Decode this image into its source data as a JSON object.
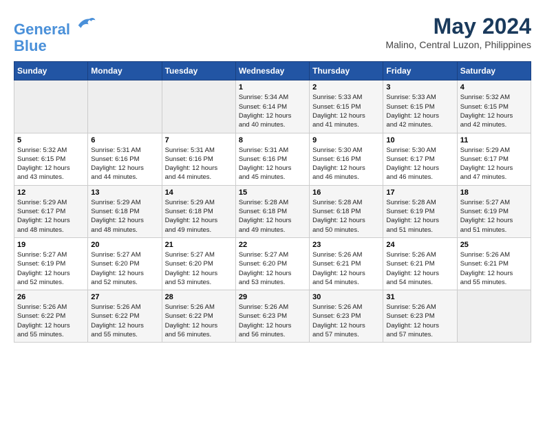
{
  "header": {
    "logo_line1": "General",
    "logo_line2": "Blue",
    "month_year": "May 2024",
    "location": "Malino, Central Luzon, Philippines"
  },
  "days_of_week": [
    "Sunday",
    "Monday",
    "Tuesday",
    "Wednesday",
    "Thursday",
    "Friday",
    "Saturday"
  ],
  "weeks": [
    [
      {
        "day": "",
        "info": ""
      },
      {
        "day": "",
        "info": ""
      },
      {
        "day": "",
        "info": ""
      },
      {
        "day": "1",
        "info": "Sunrise: 5:34 AM\nSunset: 6:14 PM\nDaylight: 12 hours\nand 40 minutes."
      },
      {
        "day": "2",
        "info": "Sunrise: 5:33 AM\nSunset: 6:15 PM\nDaylight: 12 hours\nand 41 minutes."
      },
      {
        "day": "3",
        "info": "Sunrise: 5:33 AM\nSunset: 6:15 PM\nDaylight: 12 hours\nand 42 minutes."
      },
      {
        "day": "4",
        "info": "Sunrise: 5:32 AM\nSunset: 6:15 PM\nDaylight: 12 hours\nand 42 minutes."
      }
    ],
    [
      {
        "day": "5",
        "info": "Sunrise: 5:32 AM\nSunset: 6:15 PM\nDaylight: 12 hours\nand 43 minutes."
      },
      {
        "day": "6",
        "info": "Sunrise: 5:31 AM\nSunset: 6:16 PM\nDaylight: 12 hours\nand 44 minutes."
      },
      {
        "day": "7",
        "info": "Sunrise: 5:31 AM\nSunset: 6:16 PM\nDaylight: 12 hours\nand 44 minutes."
      },
      {
        "day": "8",
        "info": "Sunrise: 5:31 AM\nSunset: 6:16 PM\nDaylight: 12 hours\nand 45 minutes."
      },
      {
        "day": "9",
        "info": "Sunrise: 5:30 AM\nSunset: 6:16 PM\nDaylight: 12 hours\nand 46 minutes."
      },
      {
        "day": "10",
        "info": "Sunrise: 5:30 AM\nSunset: 6:17 PM\nDaylight: 12 hours\nand 46 minutes."
      },
      {
        "day": "11",
        "info": "Sunrise: 5:29 AM\nSunset: 6:17 PM\nDaylight: 12 hours\nand 47 minutes."
      }
    ],
    [
      {
        "day": "12",
        "info": "Sunrise: 5:29 AM\nSunset: 6:17 PM\nDaylight: 12 hours\nand 48 minutes."
      },
      {
        "day": "13",
        "info": "Sunrise: 5:29 AM\nSunset: 6:18 PM\nDaylight: 12 hours\nand 48 minutes."
      },
      {
        "day": "14",
        "info": "Sunrise: 5:29 AM\nSunset: 6:18 PM\nDaylight: 12 hours\nand 49 minutes."
      },
      {
        "day": "15",
        "info": "Sunrise: 5:28 AM\nSunset: 6:18 PM\nDaylight: 12 hours\nand 49 minutes."
      },
      {
        "day": "16",
        "info": "Sunrise: 5:28 AM\nSunset: 6:18 PM\nDaylight: 12 hours\nand 50 minutes."
      },
      {
        "day": "17",
        "info": "Sunrise: 5:28 AM\nSunset: 6:19 PM\nDaylight: 12 hours\nand 51 minutes."
      },
      {
        "day": "18",
        "info": "Sunrise: 5:27 AM\nSunset: 6:19 PM\nDaylight: 12 hours\nand 51 minutes."
      }
    ],
    [
      {
        "day": "19",
        "info": "Sunrise: 5:27 AM\nSunset: 6:19 PM\nDaylight: 12 hours\nand 52 minutes."
      },
      {
        "day": "20",
        "info": "Sunrise: 5:27 AM\nSunset: 6:20 PM\nDaylight: 12 hours\nand 52 minutes."
      },
      {
        "day": "21",
        "info": "Sunrise: 5:27 AM\nSunset: 6:20 PM\nDaylight: 12 hours\nand 53 minutes."
      },
      {
        "day": "22",
        "info": "Sunrise: 5:27 AM\nSunset: 6:20 PM\nDaylight: 12 hours\nand 53 minutes."
      },
      {
        "day": "23",
        "info": "Sunrise: 5:26 AM\nSunset: 6:21 PM\nDaylight: 12 hours\nand 54 minutes."
      },
      {
        "day": "24",
        "info": "Sunrise: 5:26 AM\nSunset: 6:21 PM\nDaylight: 12 hours\nand 54 minutes."
      },
      {
        "day": "25",
        "info": "Sunrise: 5:26 AM\nSunset: 6:21 PM\nDaylight: 12 hours\nand 55 minutes."
      }
    ],
    [
      {
        "day": "26",
        "info": "Sunrise: 5:26 AM\nSunset: 6:22 PM\nDaylight: 12 hours\nand 55 minutes."
      },
      {
        "day": "27",
        "info": "Sunrise: 5:26 AM\nSunset: 6:22 PM\nDaylight: 12 hours\nand 55 minutes."
      },
      {
        "day": "28",
        "info": "Sunrise: 5:26 AM\nSunset: 6:22 PM\nDaylight: 12 hours\nand 56 minutes."
      },
      {
        "day": "29",
        "info": "Sunrise: 5:26 AM\nSunset: 6:23 PM\nDaylight: 12 hours\nand 56 minutes."
      },
      {
        "day": "30",
        "info": "Sunrise: 5:26 AM\nSunset: 6:23 PM\nDaylight: 12 hours\nand 57 minutes."
      },
      {
        "day": "31",
        "info": "Sunrise: 5:26 AM\nSunset: 6:23 PM\nDaylight: 12 hours\nand 57 minutes."
      },
      {
        "day": "",
        "info": ""
      }
    ]
  ]
}
